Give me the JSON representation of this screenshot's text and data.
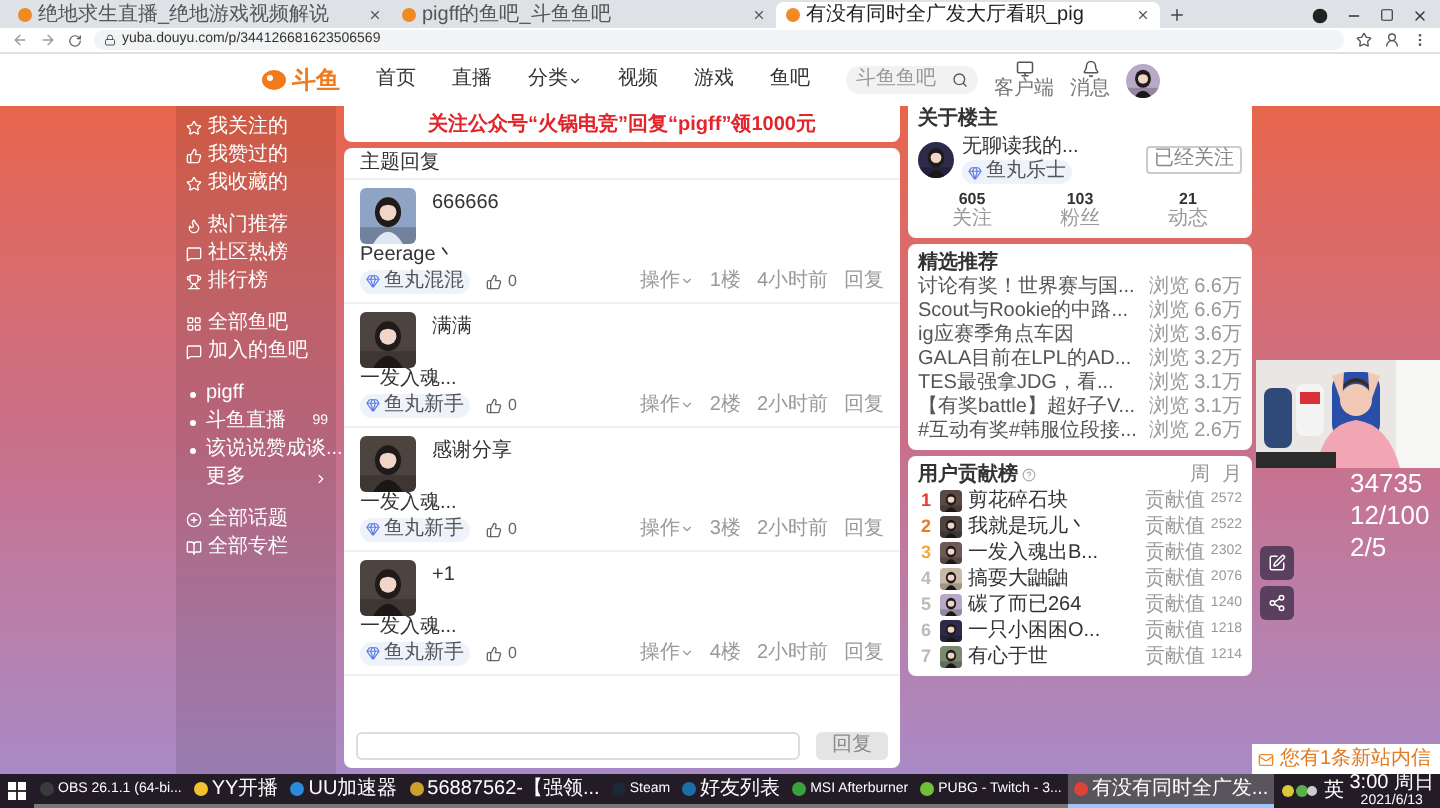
{
  "browser": {
    "tabs": [
      {
        "title": "绝地求生直播_绝地游戏视频解说",
        "selected": false
      },
      {
        "title": "pigff的鱼吧_斗鱼鱼吧",
        "selected": false
      },
      {
        "title": "有没有同时全广发大厅看职_pig",
        "selected": true
      }
    ],
    "url": "yuba.douyu.com/p/344126681623506569"
  },
  "site": {
    "logo": "斗鱼",
    "nav": [
      {
        "label": "首页",
        "has_menu": false
      },
      {
        "label": "直播",
        "has_menu": false
      },
      {
        "label": "分类",
        "has_menu": true
      },
      {
        "label": "视频",
        "has_menu": false
      },
      {
        "label": "游戏",
        "has_menu": false
      },
      {
        "label": "鱼吧",
        "has_menu": false
      }
    ],
    "search": {
      "placeholder": "斗鱼鱼吧"
    },
    "actions": [
      {
        "label": "客户端"
      },
      {
        "label": "消息"
      }
    ]
  },
  "sidebar": {
    "groups": [
      [
        {
          "label": "我关注的",
          "kind": "icon"
        },
        {
          "label": "我赞过的",
          "kind": "icon"
        },
        {
          "label": "我收藏的",
          "kind": "icon"
        }
      ],
      [
        {
          "label": "热门推荐",
          "kind": "icon"
        },
        {
          "label": "社区热榜",
          "kind": "icon"
        },
        {
          "label": "排行榜",
          "kind": "icon"
        }
      ],
      [
        {
          "label": "全部鱼吧",
          "kind": "icon"
        },
        {
          "label": "加入的鱼吧",
          "kind": "icon"
        }
      ],
      [
        {
          "label": "pigff",
          "kind": "bullet"
        },
        {
          "label": "斗鱼直播",
          "kind": "bullet",
          "count": "99"
        },
        {
          "label": "该说说赞成谈...",
          "kind": "bullet"
        },
        {
          "label": "更多",
          "kind": "more"
        }
      ],
      [
        {
          "label": "全部话题",
          "kind": "icon"
        },
        {
          "label": "全部专栏",
          "kind": "icon"
        }
      ]
    ]
  },
  "banner": "关注公众号“火锅电竞”回复“pigff”领1000元",
  "thread": {
    "title": "主题回复",
    "posts": [
      {
        "content": "666666",
        "author": "Peerage丶",
        "badge": "鱼丸混混",
        "likes": "0",
        "action": "操作",
        "floor": "1楼",
        "time": "4小时前",
        "reply": "回复"
      },
      {
        "content": "满满",
        "author": "一发入魂...",
        "badge": "鱼丸新手",
        "likes": "0",
        "action": "操作",
        "floor": "2楼",
        "time": "2小时前",
        "reply": "回复"
      },
      {
        "content": "感谢分享",
        "author": "一发入魂...",
        "badge": "鱼丸新手",
        "likes": "0",
        "action": "操作",
        "floor": "3楼",
        "time": "2小时前",
        "reply": "回复"
      },
      {
        "content": "+1",
        "author": "一发入魂...",
        "badge": "鱼丸新手",
        "likes": "0",
        "action": "操作",
        "floor": "4楼",
        "time": "2小时前",
        "reply": "回复"
      }
    ],
    "reply_box": {
      "button": "回复",
      "disabled": true
    }
  },
  "about": {
    "title": "关于楼主",
    "name": "无聊读我的...",
    "badge": "鱼丸乐士",
    "follow_button": "已经关注",
    "stats": [
      {
        "value": "605",
        "label": "关注"
      },
      {
        "value": "103",
        "label": "粉丝"
      },
      {
        "value": "21",
        "label": "动态"
      }
    ]
  },
  "recommend": {
    "title": "精选推荐",
    "items": [
      {
        "title": "讨论有奖！世界赛与国...",
        "views": "浏览 6.6万"
      },
      {
        "title": "Scout与Rookie的中路...",
        "views": "浏览 6.6万"
      },
      {
        "title": "ig应赛季角点车因",
        "views": "浏览 3.6万"
      },
      {
        "title": "GALA目前在LPL的AD...",
        "views": "浏览 3.2万"
      },
      {
        "title": "TES最强拿JDG，看...",
        "views": "浏览 3.1万"
      },
      {
        "title": "【有奖battle】超好子V...",
        "views": "浏览 3.1万"
      },
      {
        "title": "#互动有奖#韩服位段接...",
        "views": "浏览 2.6万"
      }
    ]
  },
  "ranking": {
    "title": "用户贡献榜",
    "periods": [
      "周",
      "月"
    ],
    "entries": [
      {
        "rank": "1",
        "name": "剪花碎石块",
        "score_label": "贡献值",
        "score": "2572"
      },
      {
        "rank": "2",
        "name": "我就是玩儿丶",
        "score_label": "贡献值",
        "score": "2522"
      },
      {
        "rank": "3",
        "name": "一发入魂出B...",
        "score_label": "贡献值",
        "score": "2302"
      },
      {
        "rank": "4",
        "name": "搞耍大鼬鼬",
        "score_label": "贡献值",
        "score": "2076"
      },
      {
        "rank": "5",
        "name": "碳了而已264",
        "score_label": "贡献值",
        "score": "1240"
      },
      {
        "rank": "6",
        "name": "一只小困困O...",
        "score_label": "贡献值",
        "score": "1218"
      },
      {
        "rank": "7",
        "name": "有心于世",
        "score_label": "贡献值",
        "score": "1214"
      }
    ]
  },
  "overlay": {
    "counters": [
      "34735",
      "12/100",
      "2/5"
    ]
  },
  "notification": "您有1条新站内信",
  "taskbar": {
    "apps": [
      {
        "label": "OBS 26.1.1 (64-bi...",
        "active": false
      },
      {
        "label": "YY开播",
        "active": false
      },
      {
        "label": "UU加速器",
        "active": false
      },
      {
        "label": "56887562-【强领...",
        "active": false
      },
      {
        "label": "Steam",
        "active": false
      },
      {
        "label": "好友列表",
        "active": false
      },
      {
        "label": "MSI Afterburner",
        "active": false
      },
      {
        "label": "PUBG - Twitch - 3...",
        "active": false
      },
      {
        "label": "有没有同时全广发...",
        "active": true
      }
    ],
    "lang": "英",
    "time": "3:00 周日",
    "date": "2021/6/13"
  }
}
